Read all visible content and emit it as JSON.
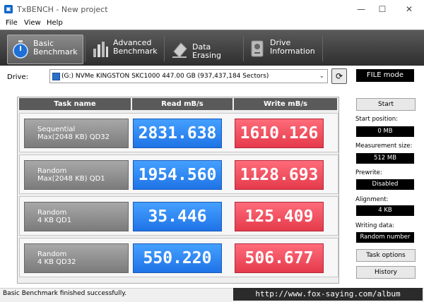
{
  "window": {
    "title": "TxBENCH - New project",
    "minimize": "—",
    "maximize": "☐",
    "close": "✕"
  },
  "menu": [
    "File",
    "View",
    "Help"
  ],
  "toolbar": {
    "tabs": [
      {
        "label": "Basic\nBenchmark",
        "icon": "stopwatch-icon",
        "active": true
      },
      {
        "label": "Advanced\nBenchmark",
        "icon": "bar-chart-icon",
        "active": false
      },
      {
        "label": "Data Erasing",
        "icon": "eraser-icon",
        "active": false
      },
      {
        "label": "Drive\nInformation",
        "icon": "drive-icon",
        "active": false
      }
    ]
  },
  "drive": {
    "label": "Drive:",
    "selected": "(G:) NVMe KINGSTON SKC1000  447.00 GB (937,437,184 Sectors)",
    "mode": "FILE mode"
  },
  "table": {
    "headers": {
      "task": "Task name",
      "read": "Read mB/s",
      "write": "Write mB/s"
    },
    "rows": [
      {
        "task": "Sequential\nMax(2048 KB) QD32",
        "read": "2831.638",
        "write": "1610.126"
      },
      {
        "task": "Random\nMax(2048 KB) QD1",
        "read": "1954.560",
        "write": "1128.693"
      },
      {
        "task": "Random\n4 KB QD1",
        "read": "35.446",
        "write": "125.409"
      },
      {
        "task": "Random\n4 KB QD32",
        "read": "550.220",
        "write": "506.677"
      }
    ]
  },
  "side": {
    "start": "Start",
    "start_position_label": "Start position:",
    "start_position": "0 MB",
    "measurement_size_label": "Measurement size:",
    "measurement_size": "512 MB",
    "prewrite_label": "Prewrite:",
    "prewrite": "Disabled",
    "alignment_label": "Alignment:",
    "alignment": "4 KB",
    "writing_data_label": "Writing data:",
    "writing_data": "Random number",
    "task_options": "Task options",
    "history": "History"
  },
  "status": "Basic Benchmark finished successfully.",
  "watermark": "http://www.fox-saying.com/album",
  "colors": {
    "read": "#2f86f5",
    "write": "#f0505f",
    "toolbar": "#3e3e3e"
  }
}
